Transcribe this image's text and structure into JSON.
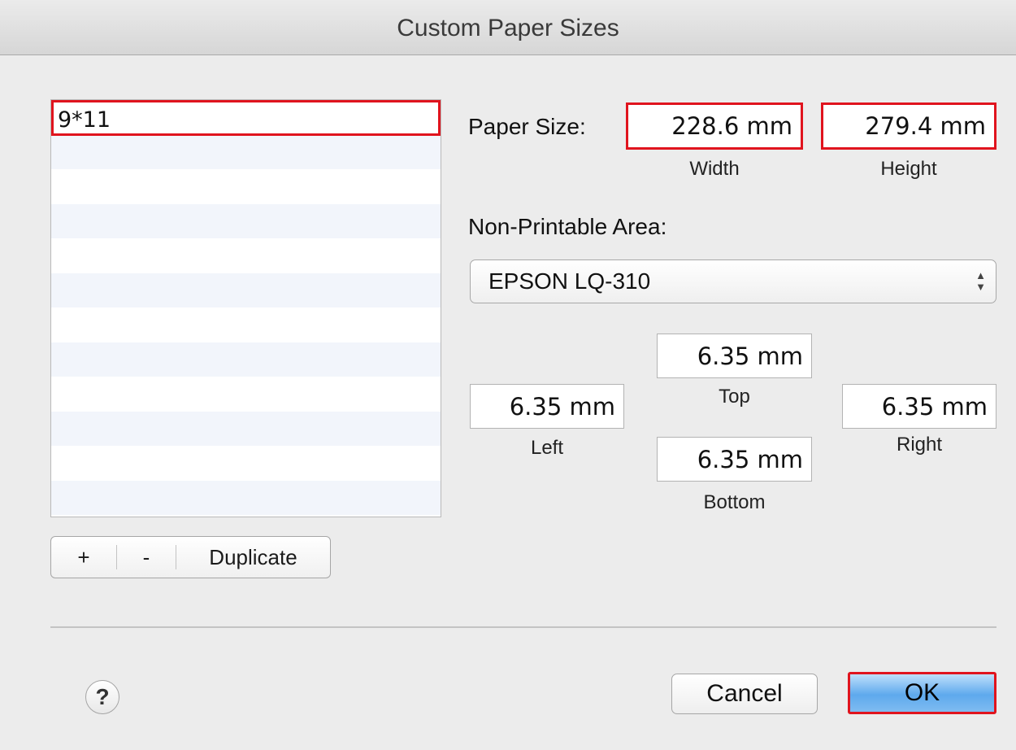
{
  "window": {
    "title": "Custom Paper Sizes"
  },
  "list": {
    "items": [
      "9*11"
    ],
    "selected_index": 0
  },
  "list_controls": {
    "add_label": "+",
    "remove_label": "-",
    "duplicate_label": "Duplicate"
  },
  "paper_size": {
    "label": "Paper Size:",
    "width_value": "228.6 mm",
    "width_label": "Width",
    "height_value": "279.4 mm",
    "height_label": "Height"
  },
  "non_printable": {
    "label": "Non-Printable Area:",
    "printer": "EPSON LQ-310",
    "top_value": "6.35 mm",
    "top_label": "Top",
    "left_value": "6.35 mm",
    "left_label": "Left",
    "right_value": "6.35 mm",
    "right_label": "Right",
    "bottom_value": "6.35 mm",
    "bottom_label": "Bottom"
  },
  "buttons": {
    "help_label": "?",
    "cancel_label": "Cancel",
    "ok_label": "OK"
  },
  "colors": {
    "highlight": "#e0141e",
    "default_button": "#5ea9ed"
  }
}
